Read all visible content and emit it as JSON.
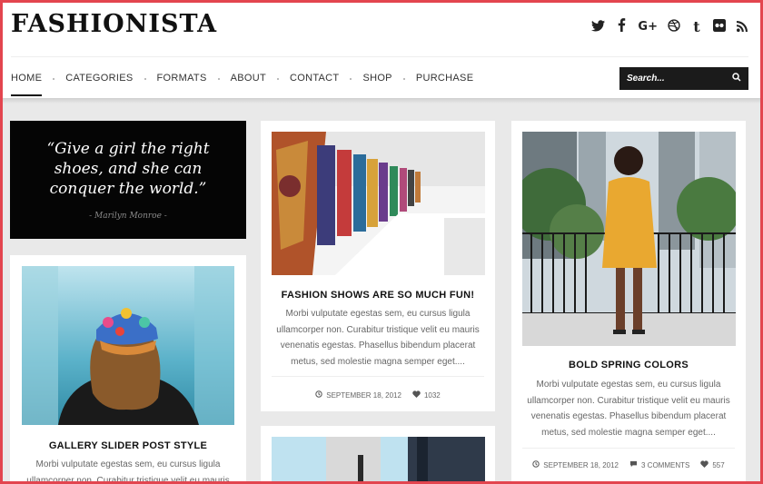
{
  "site": {
    "logo": "FASHIONISTA"
  },
  "social": [
    {
      "name": "twitter",
      "glyph": "t"
    },
    {
      "name": "facebook",
      "glyph": "f"
    },
    {
      "name": "google-plus",
      "glyph": "G+"
    },
    {
      "name": "dribbble",
      "glyph": "⊛"
    },
    {
      "name": "tumblr",
      "glyph": "t"
    },
    {
      "name": "flickr",
      "glyph": "••"
    },
    {
      "name": "rss",
      "glyph": "))"
    }
  ],
  "nav": [
    "HOME",
    "CATEGORIES",
    "FORMATS",
    "ABOUT",
    "CONTACT",
    "SHOP",
    "PURCHASE"
  ],
  "search": {
    "placeholder": "Search..."
  },
  "quote": {
    "text": "“Give a girl the right shoes, and she can conquer the world.”",
    "author": "- Marilyn Monroe -"
  },
  "posts": [
    {
      "title": "FASHION SHOWS ARE SO MUCH FUN!",
      "excerpt": "Morbi vulputate egestas sem, eu cursus ligula ullamcorper non. Curabitur tristique velit eu mauris venenatis egestas. Phasellus bibendum placerat metus, sed molestie magna semper eget....",
      "date": "SEPTEMBER 18, 2012",
      "likes": "1032"
    },
    {
      "title": "BOLD SPRING COLORS",
      "excerpt": "Morbi vulputate egestas sem, eu cursus ligula ullamcorper non. Curabitur tristique velit eu mauris venenatis egestas. Phasellus bibendum placerat metus, sed molestie magna semper eget....",
      "date": "SEPTEMBER 18, 2012",
      "comments": "3 COMMENTS",
      "likes": "557"
    },
    {
      "title": "GALLERY SLIDER POST STYLE",
      "excerpt": "Morbi vulputate egestas sem, eu cursus ligula ullamcorper non. Curabitur tristique velit eu mauris"
    }
  ],
  "colors": {
    "frame": "#e3454f",
    "dark": "#111111",
    "background": "#e9e9e9"
  }
}
